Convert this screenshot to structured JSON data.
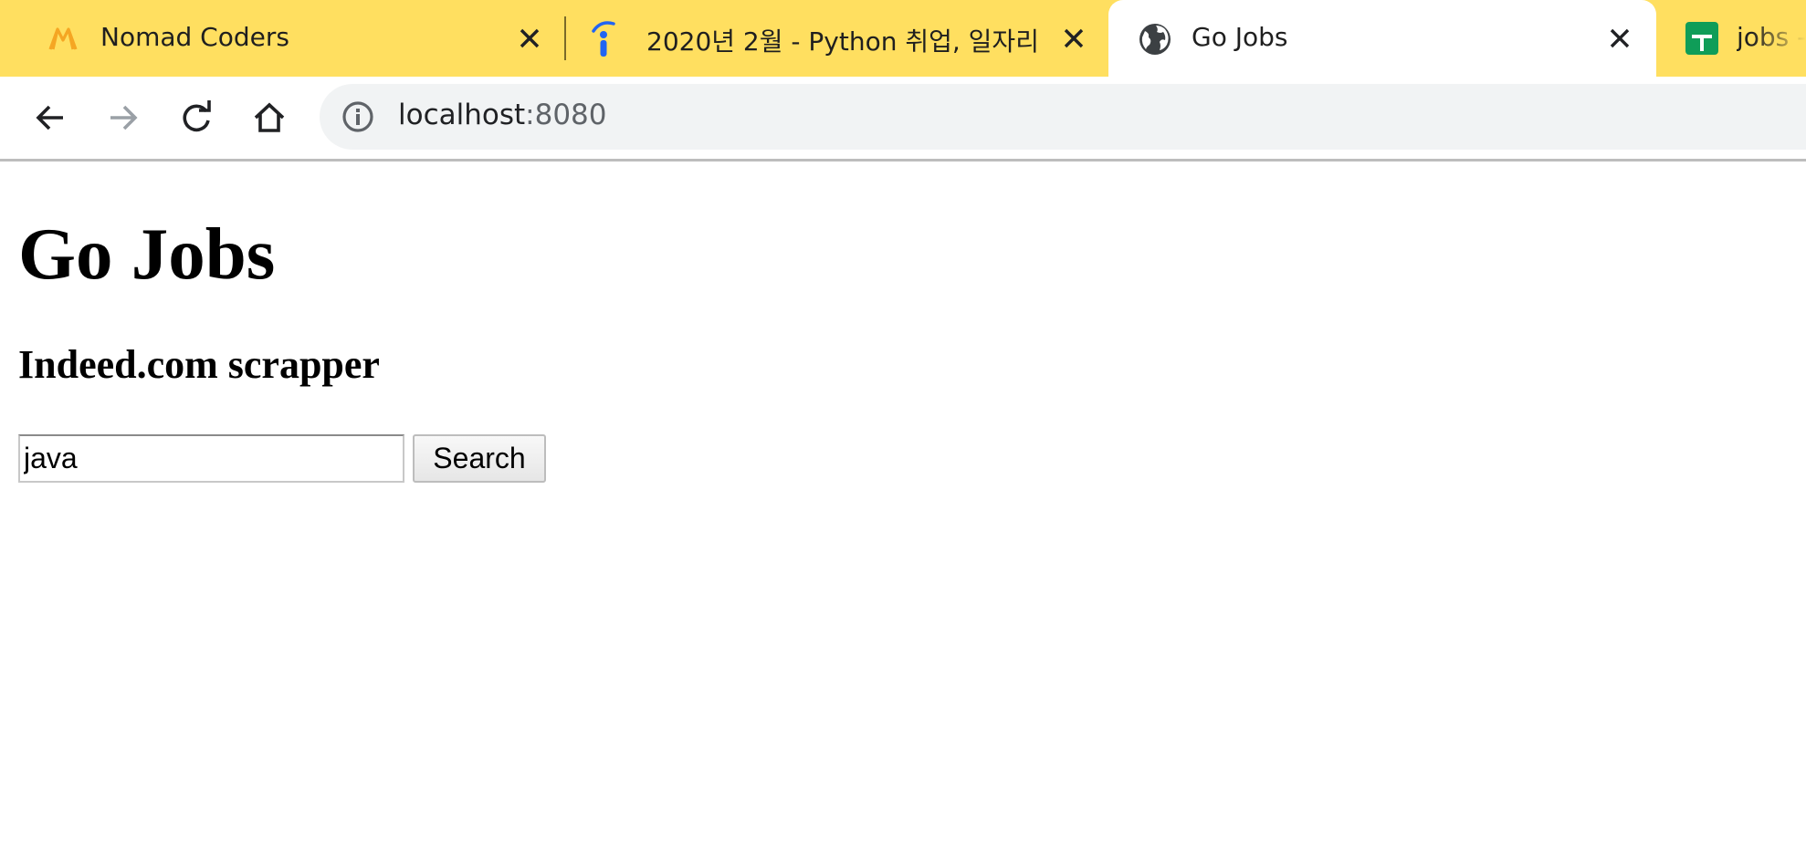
{
  "browser": {
    "tabs": [
      {
        "title": "Nomad Coders",
        "icon": "nomad-coders-logo-icon"
      },
      {
        "title": "2020년 2월 - Python 취업, 일자리",
        "icon": "indeed-logo-icon"
      },
      {
        "title": "Go Jobs",
        "icon": "globe-icon",
        "active": true
      },
      {
        "title": "jobs -",
        "icon": "google-sheets-icon"
      }
    ],
    "address_bar": {
      "host": "localhost",
      "port": ":8080"
    },
    "colors": {
      "tab_strip": "#ffdf60",
      "nomad_logo": "#f5a623",
      "indeed_blue": "#2164f3",
      "sheets_green": "#0f9d58"
    }
  },
  "page": {
    "title": "Go Jobs",
    "subtitle": "Indeed.com scrapper",
    "search": {
      "value": "java",
      "button_label": "Search"
    }
  }
}
